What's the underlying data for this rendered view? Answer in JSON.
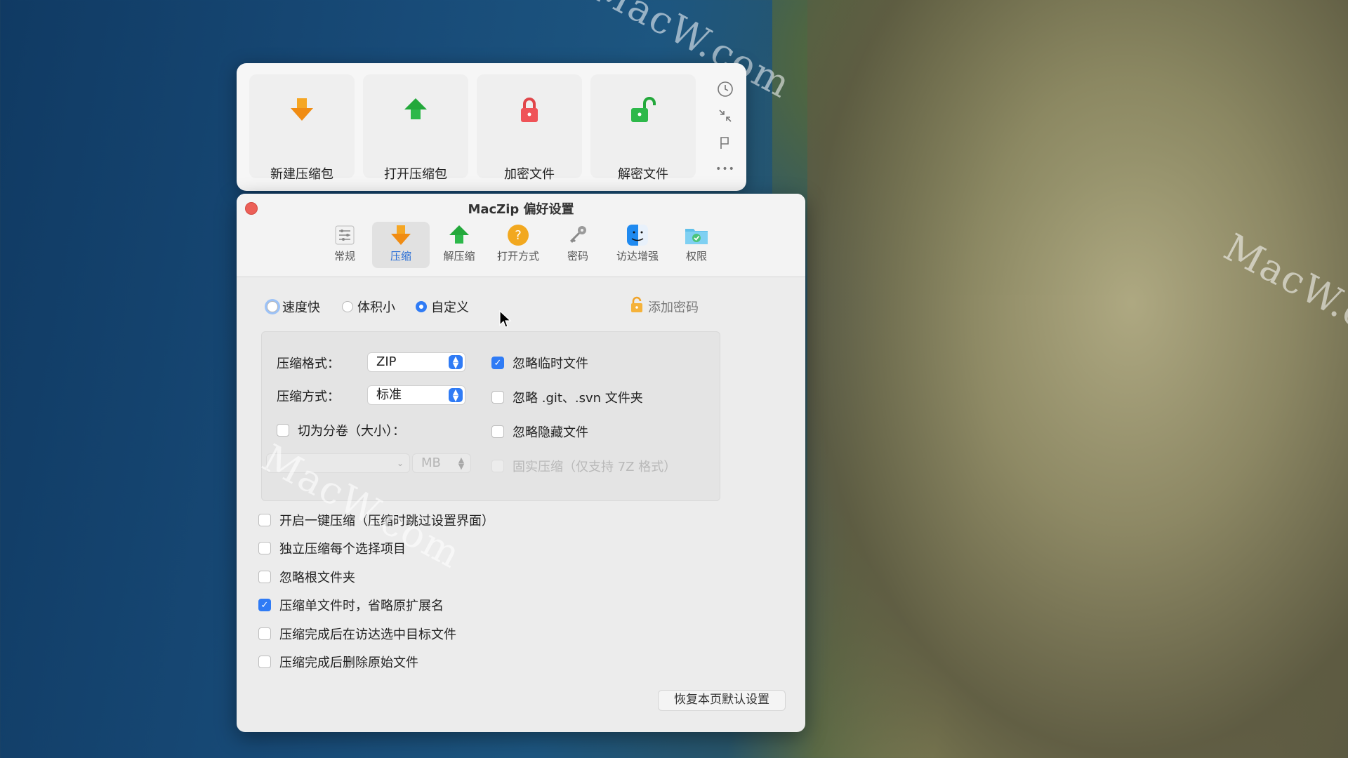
{
  "quick_panel": {
    "buttons": [
      {
        "label": "新建压缩包",
        "icon": "arrow-down-icon"
      },
      {
        "label": "打开压缩包",
        "icon": "arrow-up-icon"
      },
      {
        "label": "加密文件",
        "icon": "lock-closed-icon"
      },
      {
        "label": "解密文件",
        "icon": "lock-open-icon"
      }
    ],
    "side_icons": [
      "history-icon",
      "collapse-icon",
      "pin-icon",
      "more-icon"
    ],
    "more_glyph": "•••"
  },
  "window": {
    "title": "MacZip 偏好设置",
    "tabs": [
      {
        "label": "常规",
        "icon": "sliders-icon"
      },
      {
        "label": "压缩",
        "icon": "compress-arrow-icon"
      },
      {
        "label": "解压缩",
        "icon": "extract-arrow-icon"
      },
      {
        "label": "打开方式",
        "icon": "question-icon"
      },
      {
        "label": "密码",
        "icon": "keys-icon"
      },
      {
        "label": "访达增强",
        "icon": "finder-icon"
      },
      {
        "label": "权限",
        "icon": "folder-check-icon"
      }
    ],
    "active_tab": "压缩"
  },
  "mode": {
    "options": [
      "速度快",
      "体积小",
      "自定义"
    ],
    "selected": "自定义",
    "add_password": "添加密码"
  },
  "format": {
    "format_label": "压缩格式：",
    "format_value": "ZIP",
    "method_label": "压缩方式：",
    "method_value": "标准",
    "split_label": "切为分卷（大小）：",
    "split_unit": "MB"
  },
  "group_checks": [
    {
      "label": "忽略临时文件",
      "checked": true,
      "disabled": false
    },
    {
      "label": "忽略 .git、.svn 文件夹",
      "checked": false,
      "disabled": false
    },
    {
      "label": "忽略隐藏文件",
      "checked": false,
      "disabled": false
    },
    {
      "label": "固实压缩（仅支持 7Z 格式）",
      "checked": false,
      "disabled": true
    }
  ],
  "options": [
    {
      "label": "开启一键压缩（压缩时跳过设置界面）",
      "checked": false
    },
    {
      "label": "独立压缩每个选择项目",
      "checked": false
    },
    {
      "label": "忽略根文件夹",
      "checked": false
    },
    {
      "label": "压缩单文件时，省略原扩展名",
      "checked": true
    },
    {
      "label": "压缩完成后在访达选中目标文件",
      "checked": false
    },
    {
      "label": "压缩完成后删除原始文件",
      "checked": false
    }
  ],
  "restore_button": "恢复本页默认设置",
  "check_glyph": "✓",
  "watermark": "MacW.com"
}
